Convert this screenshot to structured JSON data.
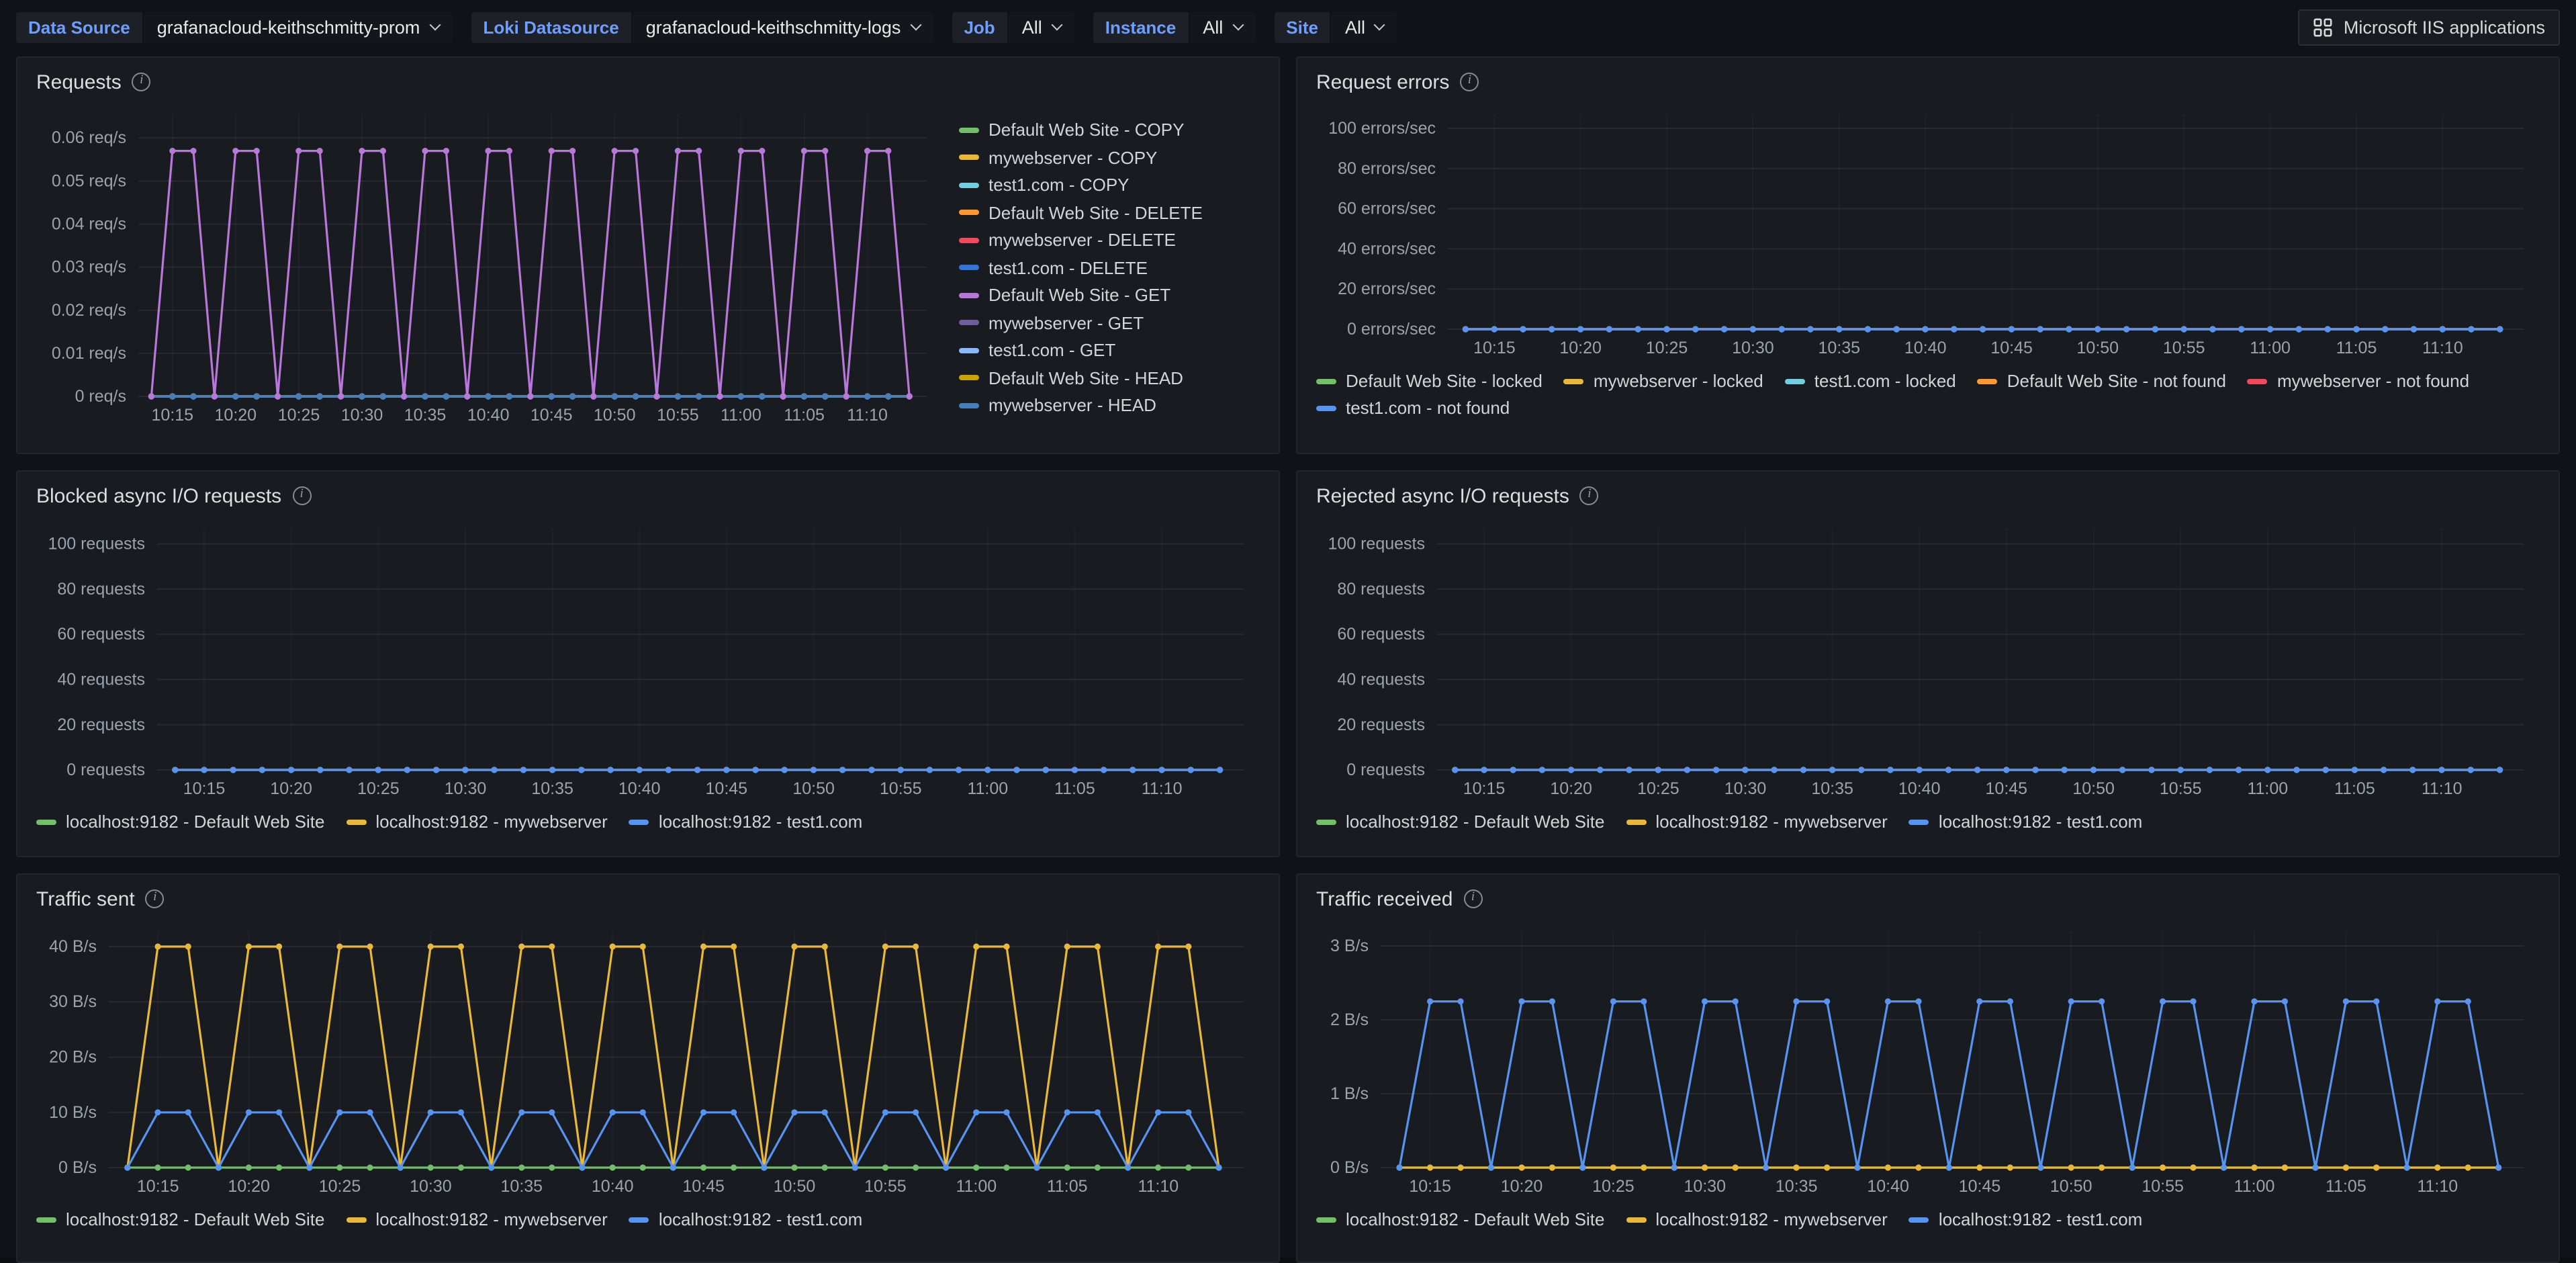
{
  "colors": {
    "page_bg": "#111217",
    "panel_bg": "#181b1f",
    "panel_border": "#22252b",
    "accent_blue": "#6e9fff",
    "text": "#d8d9da",
    "tick_text": "#9da3ad",
    "grid": "rgba(204,204,220,0.09)",
    "grid_v": "rgba(204,204,220,0.04)"
  },
  "toolbar": {
    "variables": [
      {
        "label": "Data Source",
        "value": "grafanacloud-keithschmitty-prom"
      },
      {
        "label": "Loki Datasource",
        "value": "grafanacloud-keithschmitty-logs"
      },
      {
        "label": "Job",
        "value": "All"
      },
      {
        "label": "Instance",
        "value": "All"
      },
      {
        "label": "Site",
        "value": "All"
      }
    ],
    "app_button_label": "Microsoft IIS applications"
  },
  "time_axis": {
    "x_min": 12.3,
    "x_max": 74.7,
    "x_start": 13.33,
    "x_step": 1.6667,
    "n": 37,
    "ticks": [
      {
        "m": 15,
        "label": "10:15"
      },
      {
        "m": 20,
        "label": "10:20"
      },
      {
        "m": 25,
        "label": "10:25"
      },
      {
        "m": 30,
        "label": "10:30"
      },
      {
        "m": 35,
        "label": "10:35"
      },
      {
        "m": 40,
        "label": "10:40"
      },
      {
        "m": 45,
        "label": "10:45"
      },
      {
        "m": 50,
        "label": "10:50"
      },
      {
        "m": 55,
        "label": "10:55"
      },
      {
        "m": 60,
        "label": "11:00"
      },
      {
        "m": 65,
        "label": "11:05"
      },
      {
        "m": 70,
        "label": "11:10"
      }
    ]
  },
  "panels": [
    {
      "title": "Requests"
    },
    {
      "title": "Request errors"
    },
    {
      "title": "Blocked async I/O requests"
    },
    {
      "title": "Rejected async I/O requests"
    },
    {
      "title": "Traffic sent"
    },
    {
      "title": "Traffic received"
    }
  ],
  "chart_data": [
    {
      "type": "line",
      "title": "Requests",
      "ylabel": "req/s",
      "ylim": [
        0,
        0.0655
      ],
      "legend_position": "right",
      "layout": {
        "pad_left": 78
      },
      "y_ticks": [
        {
          "v": 0,
          "label": "0 req/s"
        },
        {
          "v": 0.01,
          "label": "0.01 req/s"
        },
        {
          "v": 0.02,
          "label": "0.02 req/s"
        },
        {
          "v": 0.03,
          "label": "0.03 req/s"
        },
        {
          "v": 0.04,
          "label": "0.04 req/s"
        },
        {
          "v": 0.05,
          "label": "0.05 req/s"
        },
        {
          "v": 0.06,
          "label": "0.06 req/s"
        }
      ],
      "series": [
        {
          "name": "Default Web Site - COPY",
          "color": "#73BF69",
          "const_value": 0
        },
        {
          "name": "mywebserver - COPY",
          "color": "#EAB839",
          "const_value": 0
        },
        {
          "name": "test1.com - COPY",
          "color": "#6ED0E0",
          "const_value": 0
        },
        {
          "name": "Default Web Site - DELETE",
          "color": "#FF9830",
          "const_value": 0
        },
        {
          "name": "mywebserver - DELETE",
          "color": "#F2495C",
          "const_value": 0
        },
        {
          "name": "test1.com - DELETE",
          "color": "#3274D9",
          "const_value": 0
        },
        {
          "name": "Default Web Site - GET",
          "color": "#B877D9",
          "values": [
            0,
            0.057,
            0.057,
            0,
            0.057,
            0.057,
            0,
            0.057,
            0.057,
            0,
            0.057,
            0.057,
            0,
            0.057,
            0.057,
            0,
            0.057,
            0.057,
            0,
            0.057,
            0.057,
            0,
            0.057,
            0.057,
            0,
            0.057,
            0.057,
            0,
            0.057,
            0.057,
            0,
            0.057,
            0.057,
            0,
            0.057,
            0.057,
            0
          ]
        },
        {
          "name": "mywebserver - GET",
          "color": "#705DA0",
          "const_value": 0
        },
        {
          "name": "test1.com - GET",
          "color": "#8AB8FF",
          "const_value": 0
        },
        {
          "name": "Default Web Site - HEAD",
          "color": "#CCA300",
          "const_value": 0
        },
        {
          "name": "mywebserver - HEAD",
          "color": "#447EBC",
          "const_value": 0
        }
      ]
    },
    {
      "type": "line",
      "title": "Request errors",
      "ylabel": "errors/sec",
      "ylim": [
        0,
        107
      ],
      "legend_position": "bottom",
      "layout": {
        "pad_left": 100
      },
      "y_ticks": [
        {
          "v": 0,
          "label": "0 errors/sec"
        },
        {
          "v": 20,
          "label": "20 errors/sec"
        },
        {
          "v": 40,
          "label": "40 errors/sec"
        },
        {
          "v": 60,
          "label": "60 errors/sec"
        },
        {
          "v": 80,
          "label": "80 errors/sec"
        },
        {
          "v": 100,
          "label": "100 errors/sec"
        }
      ],
      "series": [
        {
          "name": "Default Web Site - locked",
          "color": "#73BF69",
          "const_value": 0
        },
        {
          "name": "mywebserver - locked",
          "color": "#EAB839",
          "const_value": 0
        },
        {
          "name": "test1.com - locked",
          "color": "#6ED0E0",
          "const_value": 0
        },
        {
          "name": "Default Web Site - not found",
          "color": "#FF9830",
          "const_value": 0
        },
        {
          "name": "mywebserver - not found",
          "color": "#F2495C",
          "const_value": 0
        },
        {
          "name": "test1.com - not found",
          "color": "#5794F2",
          "const_value": 0
        }
      ]
    },
    {
      "type": "line",
      "title": "Blocked async I/O requests",
      "ylabel": "requests",
      "ylim": [
        0,
        107
      ],
      "legend_position": "bottom",
      "layout": {
        "pad_left": 92
      },
      "y_ticks": [
        {
          "v": 0,
          "label": "0 requests"
        },
        {
          "v": 20,
          "label": "20 requests"
        },
        {
          "v": 40,
          "label": "40 requests"
        },
        {
          "v": 60,
          "label": "60 requests"
        },
        {
          "v": 80,
          "label": "80 requests"
        },
        {
          "v": 100,
          "label": "100 requests"
        }
      ],
      "series": [
        {
          "name": "localhost:9182 - Default Web Site",
          "color": "#73BF69",
          "const_value": 0
        },
        {
          "name": "localhost:9182 - mywebserver",
          "color": "#EAB839",
          "const_value": 0
        },
        {
          "name": "localhost:9182 - test1.com",
          "color": "#5794F2",
          "const_value": 0
        }
      ]
    },
    {
      "type": "line",
      "title": "Rejected async I/O requests",
      "ylabel": "requests",
      "ylim": [
        0,
        107
      ],
      "legend_position": "bottom",
      "layout": {
        "pad_left": 92
      },
      "y_ticks": [
        {
          "v": 0,
          "label": "0 requests"
        },
        {
          "v": 20,
          "label": "20 requests"
        },
        {
          "v": 40,
          "label": "40 requests"
        },
        {
          "v": 60,
          "label": "60 requests"
        },
        {
          "v": 80,
          "label": "80 requests"
        },
        {
          "v": 100,
          "label": "100 requests"
        }
      ],
      "series": [
        {
          "name": "localhost:9182 - Default Web Site",
          "color": "#73BF69",
          "const_value": 0
        },
        {
          "name": "localhost:9182 - mywebserver",
          "color": "#EAB839",
          "const_value": 0
        },
        {
          "name": "localhost:9182 - test1.com",
          "color": "#5794F2",
          "const_value": 0
        }
      ]
    },
    {
      "type": "line",
      "title": "Traffic sent",
      "ylabel": "B/s",
      "ylim": [
        0,
        42.8
      ],
      "legend_position": "bottom",
      "layout": {
        "pad_left": 56
      },
      "y_ticks": [
        {
          "v": 0,
          "label": "0 B/s"
        },
        {
          "v": 10,
          "label": "10 B/s"
        },
        {
          "v": 20,
          "label": "20 B/s"
        },
        {
          "v": 30,
          "label": "30 B/s"
        },
        {
          "v": 40,
          "label": "40 B/s"
        }
      ],
      "series": [
        {
          "name": "localhost:9182 - Default Web Site",
          "color": "#73BF69",
          "const_value": 0
        },
        {
          "name": "localhost:9182 - mywebserver",
          "color": "#EAB839",
          "values": [
            0,
            40,
            40,
            0,
            40,
            40,
            0,
            40,
            40,
            0,
            40,
            40,
            0,
            40,
            40,
            0,
            40,
            40,
            0,
            40,
            40,
            0,
            40,
            40,
            0,
            40,
            40,
            0,
            40,
            40,
            0,
            40,
            40,
            0,
            40,
            40,
            0
          ]
        },
        {
          "name": "localhost:9182 - test1.com",
          "color": "#5794F2",
          "values": [
            0,
            10,
            10,
            0,
            10,
            10,
            0,
            10,
            10,
            0,
            10,
            10,
            0,
            10,
            10,
            0,
            10,
            10,
            0,
            10,
            10,
            0,
            10,
            10,
            0,
            10,
            10,
            0,
            10,
            10,
            0,
            10,
            10,
            0,
            10,
            10,
            0
          ]
        }
      ]
    },
    {
      "type": "line",
      "title": "Traffic received",
      "ylabel": "B/s",
      "ylim": [
        0,
        3.2
      ],
      "legend_position": "bottom",
      "layout": {
        "pad_left": 50
      },
      "y_ticks": [
        {
          "v": 0,
          "label": "0 B/s"
        },
        {
          "v": 1,
          "label": "1 B/s"
        },
        {
          "v": 2,
          "label": "2 B/s"
        },
        {
          "v": 3,
          "label": "3 B/s"
        }
      ],
      "series": [
        {
          "name": "localhost:9182 - Default Web Site",
          "color": "#73BF69",
          "const_value": 0
        },
        {
          "name": "localhost:9182 - mywebserver",
          "color": "#EAB839",
          "const_value": 0
        },
        {
          "name": "localhost:9182 - test1.com",
          "color": "#5794F2",
          "values": [
            0,
            2.25,
            2.25,
            0,
            2.25,
            2.25,
            0,
            2.25,
            2.25,
            0,
            2.25,
            2.25,
            0,
            2.25,
            2.25,
            0,
            2.25,
            2.25,
            0,
            2.25,
            2.25,
            0,
            2.25,
            2.25,
            0,
            2.25,
            2.25,
            0,
            2.25,
            2.25,
            0,
            2.25,
            2.25,
            0,
            2.25,
            2.25,
            0
          ]
        }
      ]
    }
  ]
}
